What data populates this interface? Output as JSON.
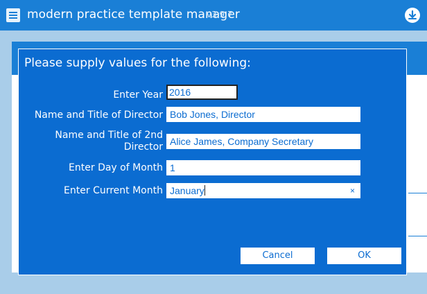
{
  "app": {
    "title": "modern practice template manager",
    "version": "v3.9.7"
  },
  "dialog": {
    "title": "Please supply values for the following:",
    "fields": [
      {
        "label": "Enter Year",
        "value": "2016"
      },
      {
        "label": "Name and Title of Director",
        "value": "Bob Jones, Director"
      },
      {
        "label_line1": "Name and Title of 2nd",
        "label_line2": "Director",
        "value": "Alice James, Company Secretary"
      },
      {
        "label": "Enter Day of Month",
        "value": "1"
      },
      {
        "label": "Enter Current Month",
        "value": "January",
        "clear": "×"
      }
    ],
    "cancel_label": "Cancel",
    "ok_label": "OK"
  },
  "colors": {
    "accent": "#1a7fd6",
    "dialog_bg": "#0b6cd1",
    "background": "#a9cde9"
  },
  "icons": {
    "app": "menu-icon",
    "download": "download-icon"
  }
}
